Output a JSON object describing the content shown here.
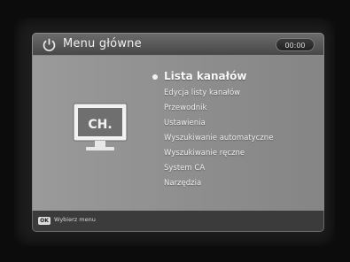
{
  "header": {
    "title": "Menu główne",
    "clock": "00:00"
  },
  "icons": {
    "header": "power-icon",
    "panel": "tv-channel-icon",
    "tv_icon_text": "CH."
  },
  "menu": {
    "items": [
      {
        "label": "Lista kanałów",
        "selected": true
      },
      {
        "label": "Edycja listy kanałów"
      },
      {
        "label": "Przewodnik"
      },
      {
        "label": "Ustawienia"
      },
      {
        "label": "Wyszukiwanie automatyczne"
      },
      {
        "label": "Wyszukiwanie ręczne"
      },
      {
        "label": "System CA"
      },
      {
        "label": "Narzędzia"
      }
    ]
  },
  "footer": {
    "key_label": "OK",
    "hint": "Wybierz menu"
  },
  "colors": {
    "panel": "#8e8e8e",
    "header": "#5a5a5a",
    "footer": "#3b3b3b",
    "text": "#eeeeee"
  }
}
